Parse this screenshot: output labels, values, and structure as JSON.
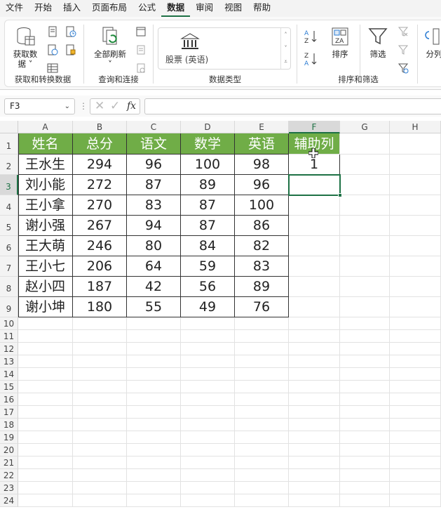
{
  "menu": [
    "文件",
    "开始",
    "插入",
    "页面布局",
    "公式",
    "数据",
    "审阅",
    "视图",
    "帮助"
  ],
  "active_menu": "数据",
  "ribbon": {
    "get_data": "获取数",
    "get_data2": "据",
    "refresh_all": "全部刷新",
    "stock": "股票 (英语)",
    "sort": "排序",
    "filter": "筛选",
    "split": "分列",
    "groups": [
      "获取和转换数据",
      "查询和连接",
      "数据类型",
      "排序和筛选"
    ]
  },
  "formula": {
    "namebox": "F3",
    "fx": "fx",
    "content": ""
  },
  "columns": [
    "A",
    "B",
    "C",
    "D",
    "E",
    "F",
    "G",
    "H"
  ],
  "rows": [
    "1",
    "2",
    "3",
    "4",
    "5",
    "6",
    "7",
    "8",
    "9",
    "10",
    "11",
    "12",
    "13",
    "14",
    "15",
    "16",
    "17",
    "18",
    "19",
    "20",
    "21",
    "22",
    "23",
    "24"
  ],
  "table": {
    "headers": [
      "姓名",
      "总分",
      "语文",
      "数学",
      "英语",
      "辅助列"
    ],
    "data": [
      [
        "王水生",
        "294",
        "96",
        "100",
        "98",
        "1"
      ],
      [
        "刘小能",
        "272",
        "87",
        "89",
        "96",
        ""
      ],
      [
        "王小拿",
        "270",
        "83",
        "87",
        "100",
        ""
      ],
      [
        "谢小强",
        "267",
        "94",
        "87",
        "86",
        ""
      ],
      [
        "王大萌",
        "246",
        "80",
        "84",
        "82",
        ""
      ],
      [
        "王小七",
        "206",
        "64",
        "59",
        "83",
        ""
      ],
      [
        "赵小四",
        "187",
        "42",
        "56",
        "89",
        ""
      ],
      [
        "谢小坤",
        "180",
        "55",
        "49",
        "76",
        ""
      ]
    ]
  },
  "colors": {
    "header_fill": "#70ad47",
    "accent": "#1e7145"
  }
}
